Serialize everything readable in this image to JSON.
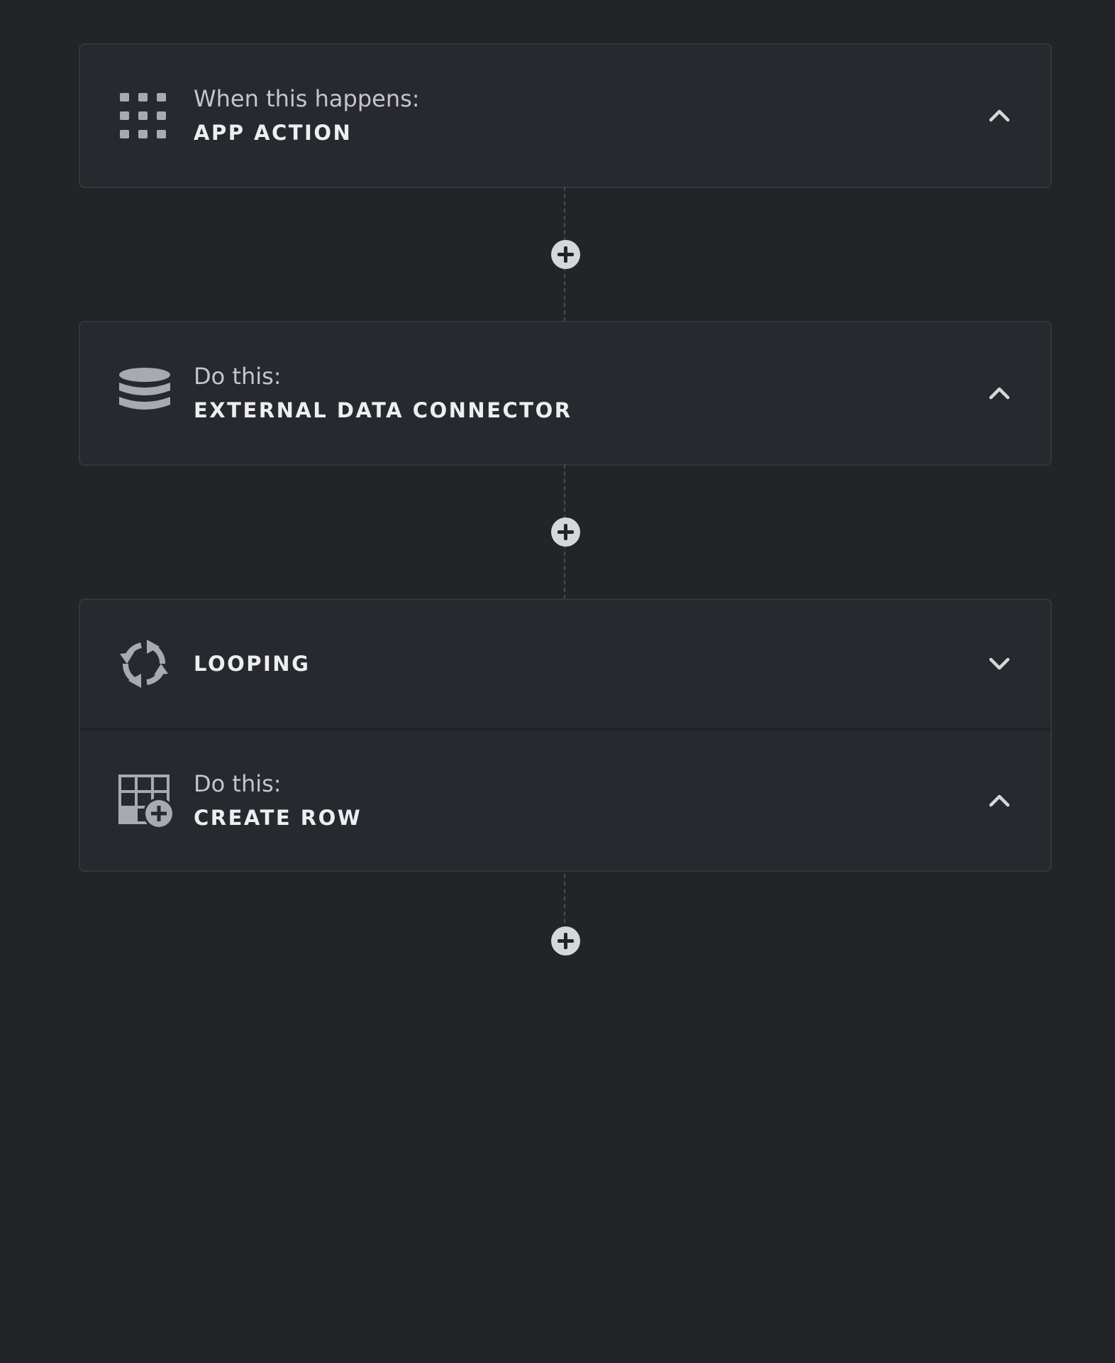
{
  "flow": {
    "trigger": {
      "label": "When this happens:",
      "title": "APP ACTION",
      "icon": "grid-dots-icon",
      "expanded": true
    },
    "step1": {
      "label": "Do this:",
      "title": "EXTERNAL DATA CONNECTOR",
      "icon": "database-icon",
      "expanded": true
    },
    "loop": {
      "title": "LOOPING",
      "icon": "loop-arrows-icon",
      "expanded": false
    },
    "step2": {
      "label": "Do this:",
      "title": "CREATE ROW",
      "icon": "table-add-row-icon",
      "expanded": true
    }
  },
  "colors": {
    "background": "#232428",
    "card": "#28292e",
    "border": "#35363c",
    "icon": "#a9aab0",
    "add_button": "#d6d7db"
  }
}
